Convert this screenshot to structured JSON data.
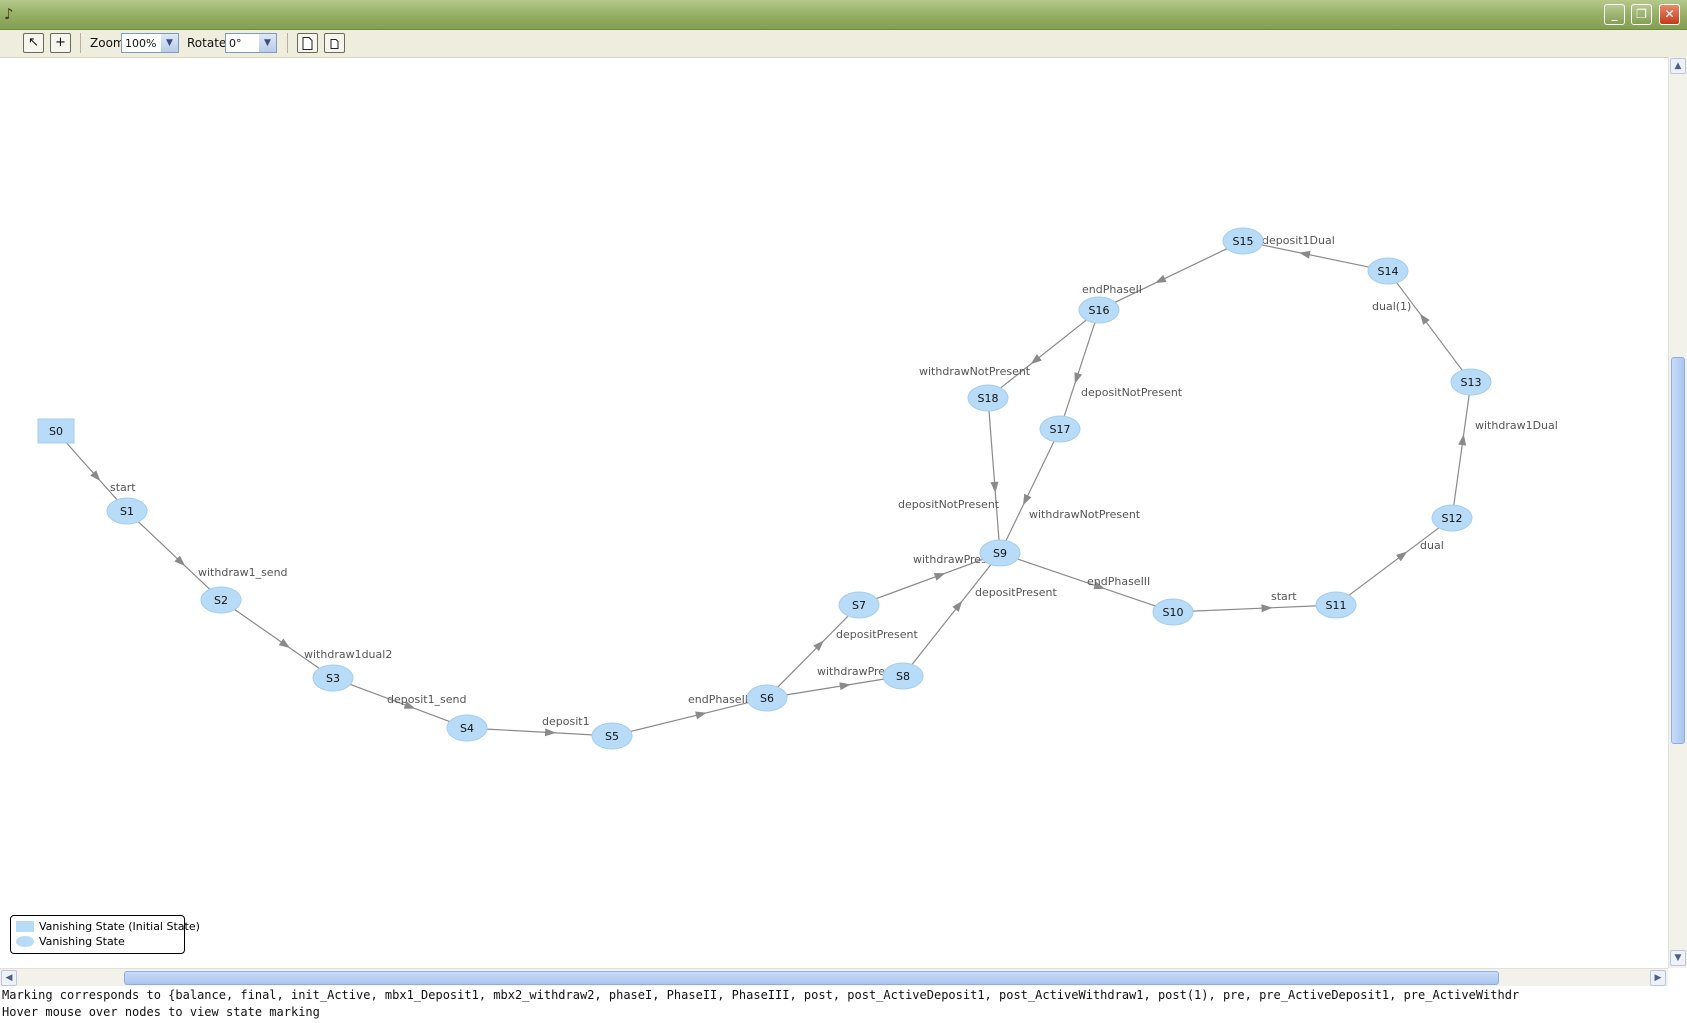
{
  "window": {
    "app_icon": "pipe-icon",
    "buttons": {
      "minimize": "_",
      "maximize": "❐",
      "close": "✕"
    }
  },
  "toolbar": {
    "select_tool": "↖",
    "add_tool": "+",
    "zoom_label": "Zoom:",
    "zoom_value": "100%",
    "rotate_label": "Rotate:",
    "rotate_value": "0°",
    "export_icon_1": "page-icon",
    "export_icon_2": "page-small-icon"
  },
  "graph": {
    "states": [
      {
        "id": "S0",
        "kind": "initial"
      },
      {
        "id": "S1",
        "kind": "vanishing"
      },
      {
        "id": "S2",
        "kind": "vanishing"
      },
      {
        "id": "S3",
        "kind": "vanishing"
      },
      {
        "id": "S4",
        "kind": "vanishing"
      },
      {
        "id": "S5",
        "kind": "vanishing"
      },
      {
        "id": "S6",
        "kind": "vanishing"
      },
      {
        "id": "S7",
        "kind": "vanishing"
      },
      {
        "id": "S8",
        "kind": "vanishing"
      },
      {
        "id": "S9",
        "kind": "vanishing"
      },
      {
        "id": "S10",
        "kind": "vanishing"
      },
      {
        "id": "S11",
        "kind": "vanishing"
      },
      {
        "id": "S12",
        "kind": "vanishing"
      },
      {
        "id": "S13",
        "kind": "vanishing"
      },
      {
        "id": "S14",
        "kind": "vanishing"
      },
      {
        "id": "S15",
        "kind": "vanishing"
      },
      {
        "id": "S16",
        "kind": "vanishing"
      },
      {
        "id": "S17",
        "kind": "vanishing"
      },
      {
        "id": "S18",
        "kind": "vanishing"
      }
    ],
    "transitions": [
      {
        "from": "S0",
        "to": "S1",
        "label": "start"
      },
      {
        "from": "S1",
        "to": "S2",
        "label": "withdraw1_send"
      },
      {
        "from": "S2",
        "to": "S3",
        "label": "withdraw1dual2"
      },
      {
        "from": "S3",
        "to": "S4",
        "label": "deposit1_send"
      },
      {
        "from": "S4",
        "to": "S5",
        "label": "deposit1"
      },
      {
        "from": "S5",
        "to": "S6",
        "label": "endPhaseII"
      },
      {
        "from": "S6",
        "to": "S7",
        "label": "depositPresent"
      },
      {
        "from": "S6",
        "to": "S8",
        "label": "withdrawPresent"
      },
      {
        "from": "S7",
        "to": "S9",
        "label": "withdrawPresent"
      },
      {
        "from": "S8",
        "to": "S9",
        "label": "depositPresent"
      },
      {
        "from": "S9",
        "to": "S10",
        "label": "endPhaseIII"
      },
      {
        "from": "S10",
        "to": "S11",
        "label": "start"
      },
      {
        "from": "S11",
        "to": "S12",
        "label": "dual"
      },
      {
        "from": "S12",
        "to": "S13",
        "label": "withdraw1Dual"
      },
      {
        "from": "S13",
        "to": "S14",
        "label": "dual(1)"
      },
      {
        "from": "S14",
        "to": "S15",
        "label": "deposit1Dual"
      },
      {
        "from": "S15",
        "to": "S16",
        "label": "endPhaseII"
      },
      {
        "from": "S16",
        "to": "S18",
        "label": "withdrawNotPresent"
      },
      {
        "from": "S16",
        "to": "S17",
        "label": "depositNotPresent"
      },
      {
        "from": "S18",
        "to": "S9",
        "label": "depositNotPresent"
      },
      {
        "from": "S17",
        "to": "S9",
        "label": "withdrawNotPresent"
      }
    ]
  },
  "legend": {
    "initial_label": "Vanishing State (Initial State)",
    "vanishing_label": "Vanishing State"
  },
  "status": {
    "line1": "Marking corresponds to {balance, final, init_Active, mbx1_Deposit1, mbx2_withdraw2, phaseI, PhaseII, PhaseIII, post, post_ActiveDeposit1, post_ActiveWithdraw1, post(1), pre, pre_ActiveDeposit1, pre_ActiveWithdr",
    "line2": "Hover mouse over nodes to view state marking"
  },
  "colors": {
    "node_fill": "#b8dcf7",
    "node_stroke": "#a3cdef",
    "edge": "#8a8a8a",
    "edge_label": "#555555",
    "titlebar": "#93ad62"
  }
}
